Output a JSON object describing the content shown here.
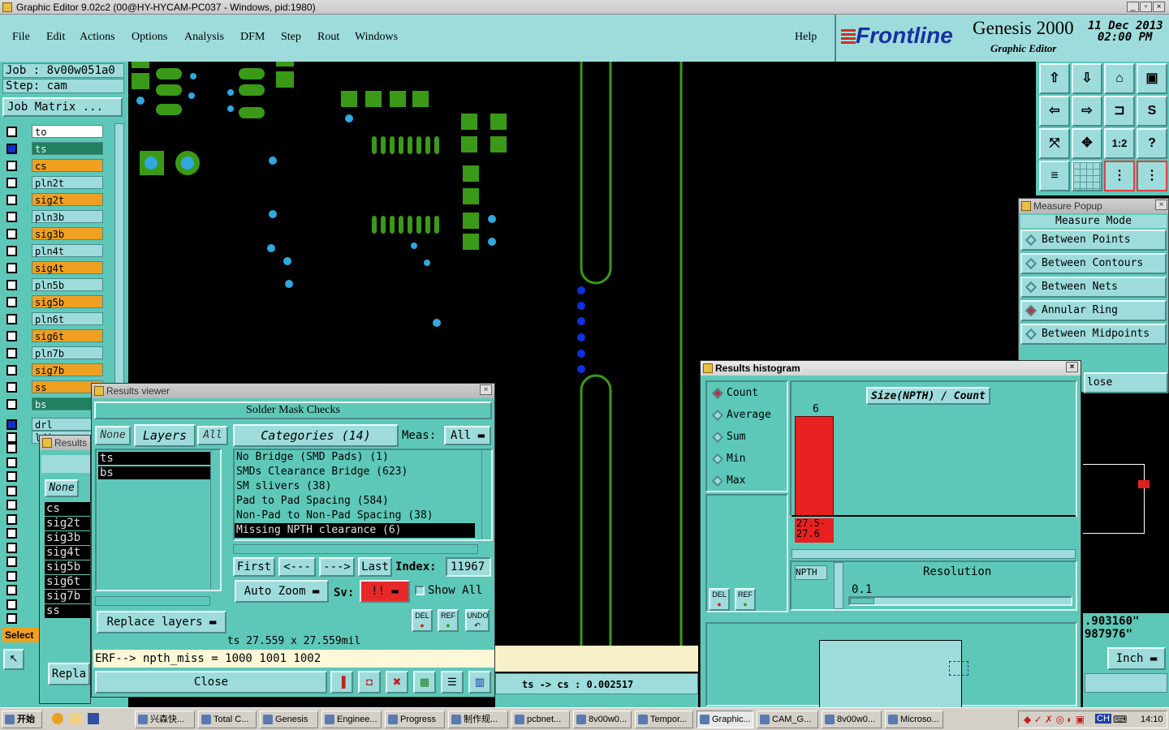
{
  "window": {
    "title": "Graphic Editor 9.02c2 (00@HY-HYCAM-PC037 - Windows, pid:1980)"
  },
  "menu": {
    "items": [
      "File",
      "Edit",
      "Actions",
      "Options",
      "Analysis",
      "DFM",
      "Step",
      "Rout",
      "Windows"
    ],
    "help": "Help"
  },
  "brand": {
    "logo": "Frontline",
    "product": "Genesis 2000",
    "subtitle": "Graphic Editor",
    "date": "11 Dec 2013",
    "time": "02:00 PM"
  },
  "job": {
    "job_label": "Job : 8v00w051a0",
    "step_label": "Step: cam",
    "matrix_button": "Job Matrix ..."
  },
  "layers": [
    {
      "name": "to",
      "color": "#ffffff"
    },
    {
      "name": "ts",
      "color": "#208060"
    },
    {
      "name": "cs",
      "color": "#f0a020"
    },
    {
      "name": "pln2t",
      "color": "#9edcdc"
    },
    {
      "name": "sig2t",
      "color": "#f0a020"
    },
    {
      "name": "pln3b",
      "color": "#9edcdc"
    },
    {
      "name": "sig3b",
      "color": "#f0a020"
    },
    {
      "name": "pln4t",
      "color": "#9edcdc"
    },
    {
      "name": "sig4t",
      "color": "#f0a020"
    },
    {
      "name": "pln5b",
      "color": "#9edcdc"
    },
    {
      "name": "sig5b",
      "color": "#f0a020"
    },
    {
      "name": "pln6t",
      "color": "#9edcdc"
    },
    {
      "name": "sig6t",
      "color": "#f0a020"
    },
    {
      "name": "pln7b",
      "color": "#9edcdc"
    },
    {
      "name": "sig7b",
      "color": "#f0a020"
    },
    {
      "name": "ss",
      "color": "#f0a020"
    },
    {
      "name": "bs",
      "color": "#208060"
    },
    {
      "name": "drl",
      "color": "#9edcdc"
    },
    {
      "name": "ldi",
      "color": "#9edcdc"
    }
  ],
  "select_label": "Select",
  "back_results": {
    "title": "Results",
    "none": "None",
    "layers": [
      "cs",
      "sig2t",
      "sig3b",
      "sig4t",
      "sig5b",
      "sig6t",
      "sig7b",
      "ss"
    ],
    "replace": "Repla"
  },
  "results_viewer": {
    "title": "Results viewer",
    "header": "Solder Mask Checks",
    "none_btn": "None",
    "layers_btn": "Layers",
    "all_btn": "All",
    "layers": [
      "ts",
      "bs"
    ],
    "categories_label": "Categories (14)",
    "meas_label": "Meas:",
    "meas_value": "All",
    "categories": [
      "No Bridge (SMD Pads) (1)",
      "SMDs Clearance Bridge (623)",
      "SM slivers (38)",
      "Pad to Pad Spacing (584)",
      "Non-Pad to Non-Pad Spacing (38)",
      "Missing NPTH clearance (6)"
    ],
    "selected_index": 5,
    "first": "First",
    "prev": "<---",
    "next": "--->",
    "last": "Last",
    "index_label": "Index:",
    "index_value": "11967",
    "auto_zoom": "Auto Zoom",
    "sv_label": "Sv:",
    "sv_value": "!!",
    "show_all": "Show All",
    "replace_layers": "Replace layers",
    "del": "DEL",
    "ref": "REF",
    "undo": "UNDO",
    "size_info": "ts 27.559 x 27.559mil",
    "erf": "ERF--> npth_miss = 1000 1001 1002",
    "close": "Close"
  },
  "status": {
    "bottom": "ts -> cs : 0.002517"
  },
  "measure_popup": {
    "title": "Measure Popup",
    "header": "Measure Mode",
    "modes": [
      "Between Points",
      "Between Contours",
      "Between Nets",
      "Annular Ring",
      "Between Midpoints"
    ],
    "selected": 3,
    "close": "lose"
  },
  "histogram": {
    "title": "Results histogram",
    "options": [
      "Count",
      "Average",
      "Sum",
      "Min",
      "Max"
    ],
    "selected": 0,
    "chart_title": "Size(NPTH) / Count",
    "bar_value": 6,
    "bar_label": "27.5-\n27.6",
    "type_label": "NPTH",
    "resolution_label": "Resolution",
    "resolution_value": "0.1",
    "del": "DEL",
    "ref": "REF"
  },
  "coords": {
    "x": ".903160\"",
    "y": "987976\"",
    "units": "Inch"
  },
  "taskbar": {
    "start": "开始",
    "tasks": [
      "兴森快...",
      "Total C...",
      "Genesis",
      "Enginee...",
      "Progress",
      "制作规...",
      "pcbnet...",
      "8v00w0...",
      "Tempor...",
      "Graphic...",
      "CAM_G...",
      "8v00w0...",
      "Microso..."
    ],
    "active": 9,
    "clock": "14:10"
  }
}
